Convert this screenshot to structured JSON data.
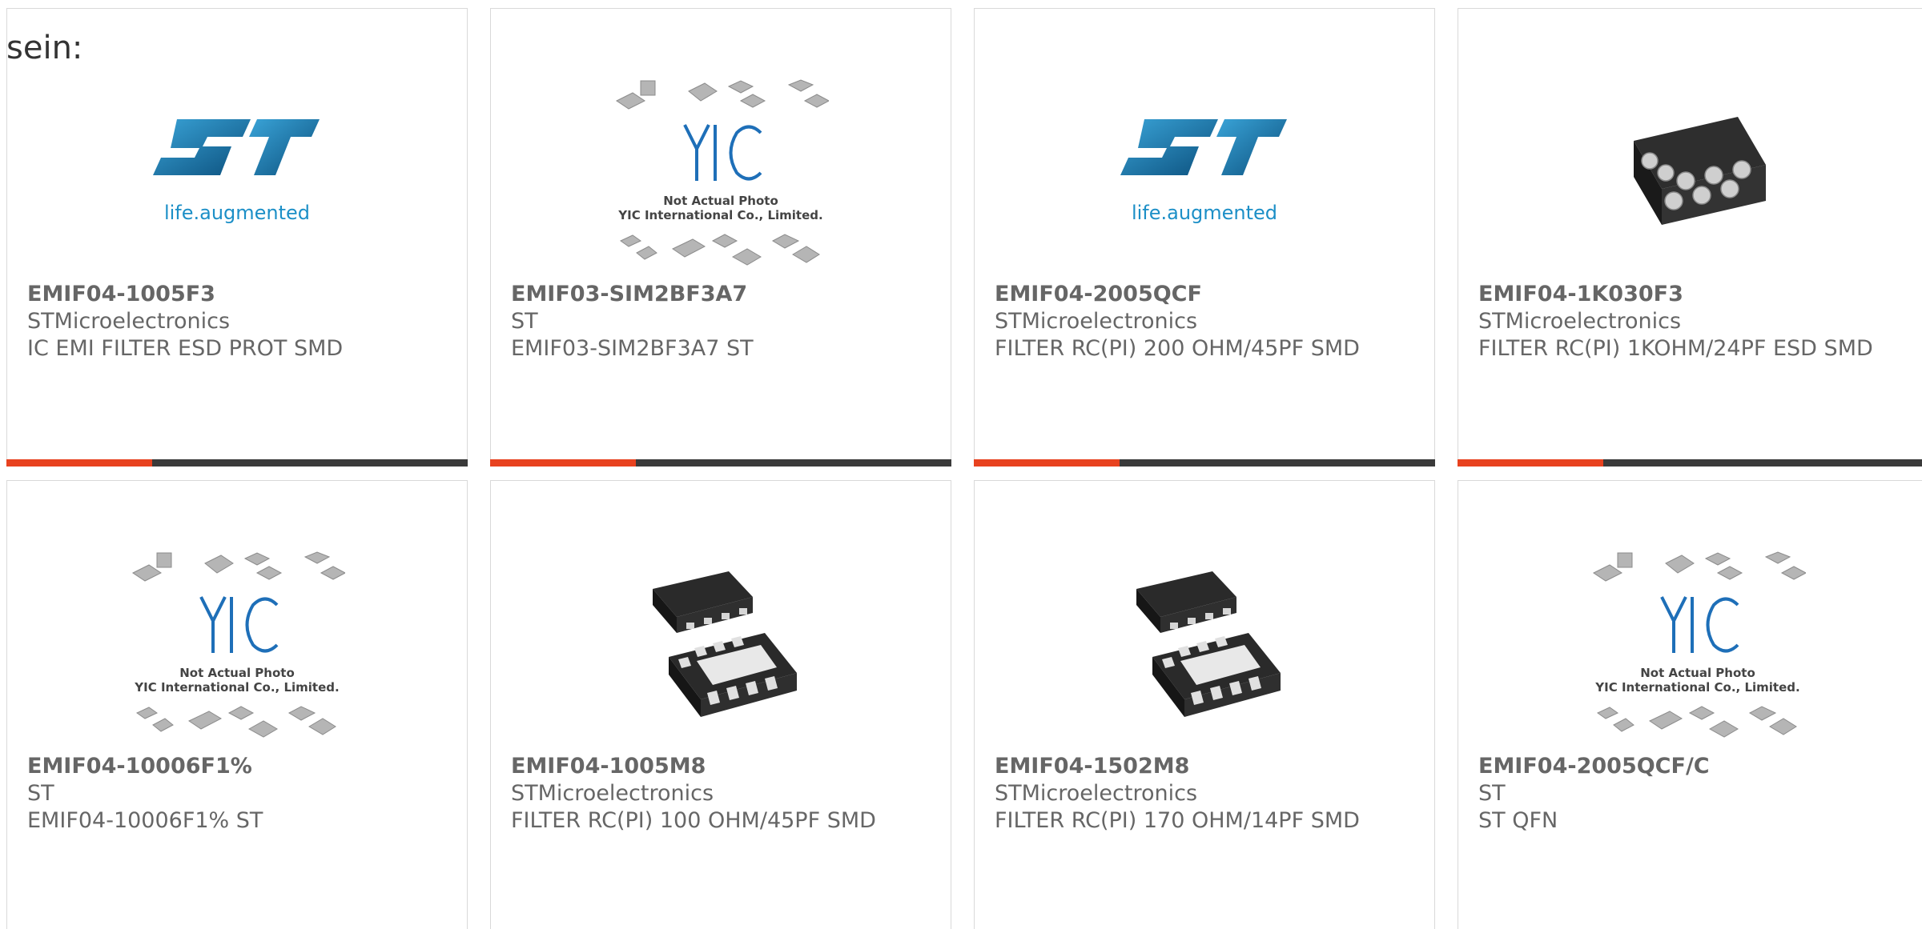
{
  "intro_text": "sein:",
  "colors": {
    "accent": "#e8421f",
    "bar_dark": "#3a3a3a",
    "text": "#666666",
    "st_logo_blue": "#1c8fc7",
    "yic_blue": "#1e6fb8"
  },
  "products": [
    {
      "part": "EMIF04-1005F3",
      "manufacturer": "STMicroelectronics",
      "description": "IC EMI FILTER ESD PROT SMD",
      "image": "st-logo",
      "logo_tagline": "life.augmented"
    },
    {
      "part": "EMIF03-SIM2BF3A7",
      "manufacturer": "ST",
      "description": "EMIF03-SIM2BF3A7 ST",
      "image": "yic-placeholder",
      "placeholder_line1": "Not Actual Photo",
      "placeholder_line2": "YIC International Co., Limited."
    },
    {
      "part": "EMIF04-2005QCF",
      "manufacturer": "STMicroelectronics",
      "description": "FILTER RC(PI) 200 OHM/45PF SMD",
      "image": "st-logo",
      "logo_tagline": "life.augmented"
    },
    {
      "part": "EMIF04-1K030F3",
      "manufacturer": "STMicroelectronics",
      "description": "FILTER RC(PI) 1KOHM/24PF ESD SMD",
      "image": "bga-chip"
    },
    {
      "part": "EMIF04-10006F1%",
      "manufacturer": "ST",
      "description": "EMIF04-10006F1% ST",
      "image": "yic-placeholder",
      "placeholder_line1": "Not Actual Photo",
      "placeholder_line2": "YIC International Co., Limited."
    },
    {
      "part": "EMIF04-1005M8",
      "manufacturer": "STMicroelectronics",
      "description": "FILTER RC(PI) 100 OHM/45PF SMD",
      "image": "dfn-chip"
    },
    {
      "part": "EMIF04-1502M8",
      "manufacturer": "STMicroelectronics",
      "description": "FILTER RC(PI) 170 OHM/14PF SMD",
      "image": "dfn-chip"
    },
    {
      "part": "EMIF04-2005QCF/C",
      "manufacturer": "ST",
      "description": "ST QFN",
      "image": "yic-placeholder",
      "placeholder_line1": "Not Actual Photo",
      "placeholder_line2": "YIC International Co., Limited."
    }
  ]
}
